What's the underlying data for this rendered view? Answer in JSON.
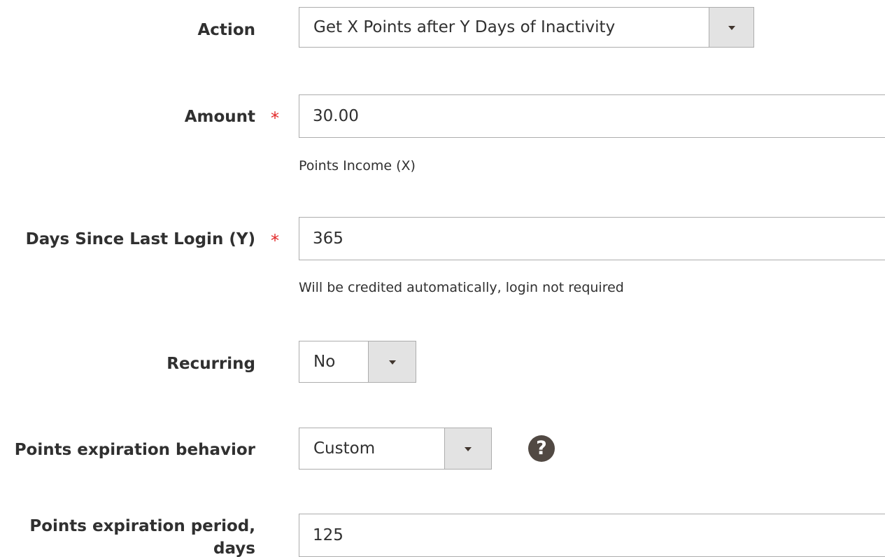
{
  "fields": {
    "action": {
      "label": "Action",
      "selected": "Get X Points after Y Days of Inactivity"
    },
    "amount": {
      "label": "Amount",
      "required_marker": "*",
      "value": "30.00",
      "note": "Points Income (X)"
    },
    "days_since_login": {
      "label": "Days Since Last Login (Y)",
      "required_marker": "*",
      "value": "365",
      "note": "Will be credited automatically, login not required"
    },
    "recurring": {
      "label": "Recurring",
      "selected": "No"
    },
    "expiration_behavior": {
      "label": "Points expiration behavior",
      "selected": "Custom",
      "help_icon": "question-mark-icon",
      "help_glyph": "?"
    },
    "expiration_period": {
      "label_line1": "Points expiration period,",
      "label_line2": "days",
      "value": "125"
    }
  },
  "colors": {
    "required": "#e22626",
    "select_arrow_bg": "#e3e3e3",
    "border": "#adadad",
    "help_icon_bg": "#514943"
  }
}
